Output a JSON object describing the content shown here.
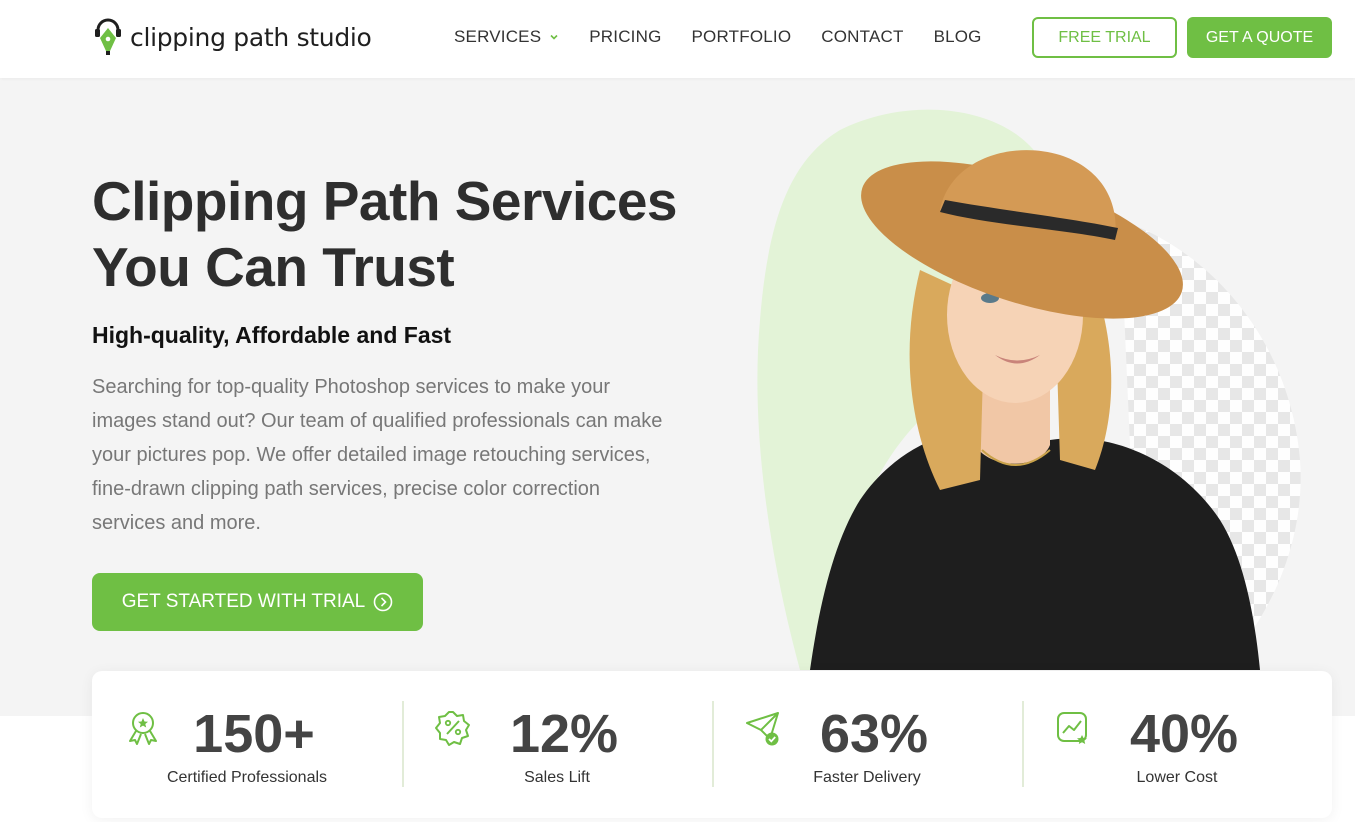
{
  "brand": {
    "name": "clipping path studio",
    "accent": "#6fbf44"
  },
  "nav": {
    "items": [
      {
        "label": "SERVICES",
        "has_dropdown": true
      },
      {
        "label": "PRICING"
      },
      {
        "label": "PORTFOLIO"
      },
      {
        "label": "CONTACT"
      },
      {
        "label": "BLOG"
      }
    ],
    "free_trial": "FREE TRIAL",
    "get_quote": "GET A QUOTE"
  },
  "hero": {
    "title": "Clipping Path Services You Can Trust",
    "subtitle": "High-quality, Affordable and Fast",
    "description": "Searching for top-quality Photoshop services to make your images stand out? Our team of qualified professionals can make your pictures pop. We offer detailed image retouching services, fine-drawn clipping path services, precise color correction services and more.",
    "cta": "GET STARTED WITH TRIAL"
  },
  "stats": [
    {
      "value": "150+",
      "label": "Certified Professionals",
      "icon": "award-icon"
    },
    {
      "value": "12%",
      "label": "Sales Lift",
      "icon": "discount-badge-icon"
    },
    {
      "value": "63%",
      "label": "Faster Delivery",
      "icon": "paper-plane-icon"
    },
    {
      "value": "40%",
      "label": "Lower Cost",
      "icon": "growth-chart-icon"
    }
  ]
}
